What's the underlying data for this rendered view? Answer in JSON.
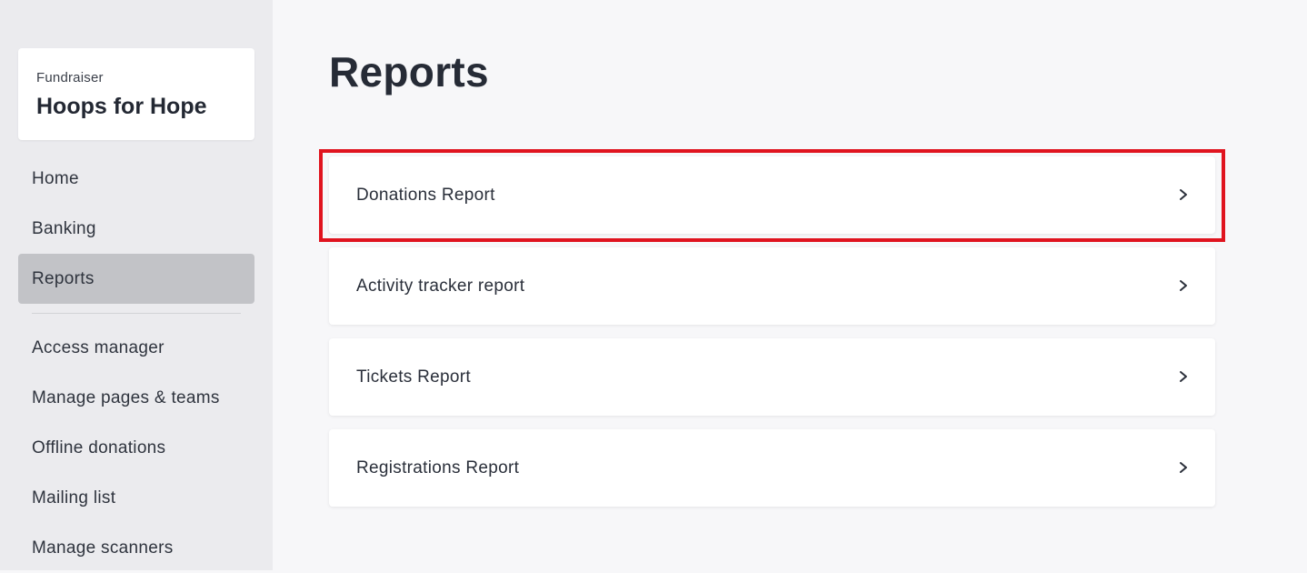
{
  "sidebar": {
    "org_card": {
      "eyebrow": "Fundraiser",
      "name": "Hoops for Hope"
    },
    "primary_items": [
      {
        "label": "Home",
        "active": false
      },
      {
        "label": "Banking",
        "active": false
      },
      {
        "label": "Reports",
        "active": true
      }
    ],
    "secondary_items": [
      {
        "label": "Access manager"
      },
      {
        "label": "Manage pages & teams"
      },
      {
        "label": "Offline donations"
      },
      {
        "label": "Mailing list"
      },
      {
        "label": "Manage scanners"
      }
    ]
  },
  "main": {
    "title": "Reports",
    "reports": [
      {
        "label": "Donations Report",
        "icon": "chevron-right-icon",
        "highlighted": true
      },
      {
        "label": "Activity tracker report",
        "icon": "chevron-right-icon",
        "highlighted": false
      },
      {
        "label": "Tickets Report",
        "icon": "chevron-right-icon",
        "highlighted": false
      },
      {
        "label": "Registrations Report",
        "icon": "chevron-right-icon",
        "highlighted": false
      }
    ]
  },
  "colors": {
    "sidebar_bg": "#ebebee",
    "page_bg": "#f7f7f9",
    "active_nav_bg": "#c2c3c7",
    "highlight_border": "#e0141f"
  }
}
